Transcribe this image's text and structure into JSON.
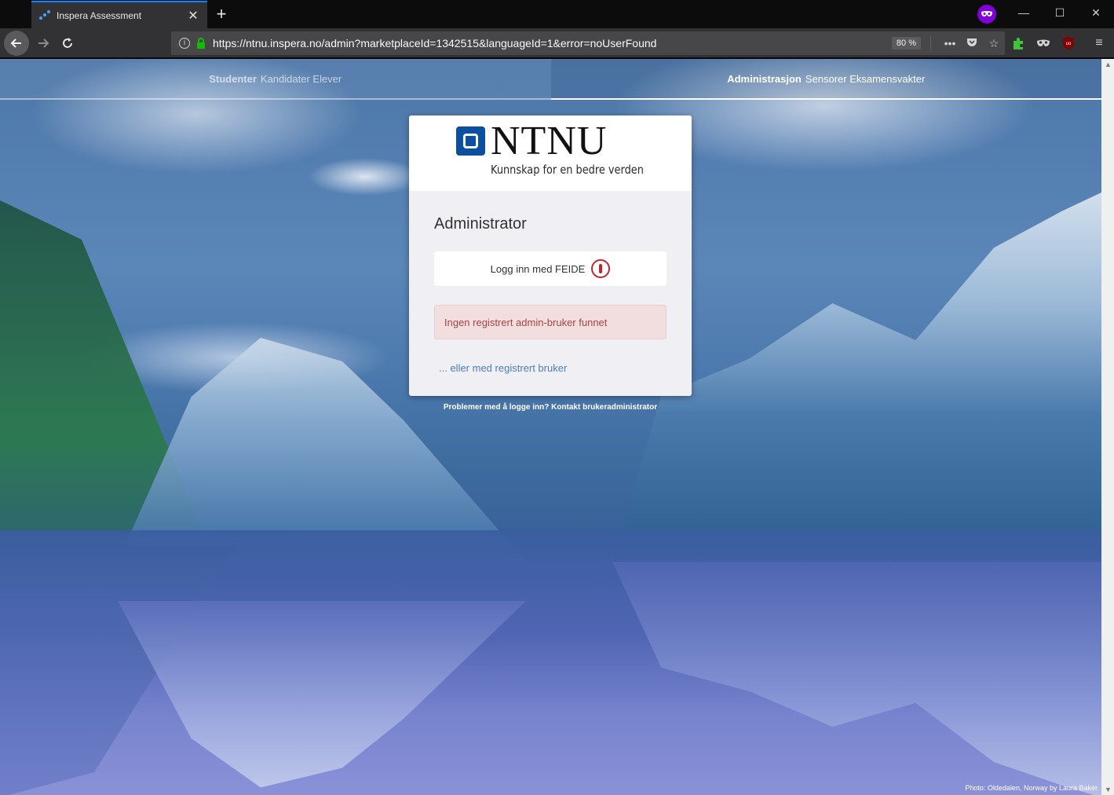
{
  "browser": {
    "tab_title": "Inspera Assessment",
    "tab_close": "✕",
    "new_tab": "+",
    "url": "https://ntnu.inspera.no/admin?marketplaceId=1342515&languageId=1&error=noUserFound",
    "zoom": "80 %",
    "icons": [
      "back-icon",
      "forward-icon",
      "reload-icon",
      "info-icon",
      "lock-icon",
      "more-icon",
      "pocket-icon",
      "star-icon",
      "extension-icon",
      "mask-icon",
      "ublock-icon",
      "menu-icon",
      "private-browsing-icon"
    ],
    "accent": "#0a84ff",
    "private_color": "#8000d7"
  },
  "role_tabs": [
    {
      "bold": "Studenter",
      "rest": "Kandidater Elever",
      "active": false
    },
    {
      "bold": "Administrasjon",
      "rest": "Sensorer Eksamensvakter",
      "active": true
    }
  ],
  "logo": {
    "wordmark": "NTNU",
    "tagline": "Kunnskap for en bedre verden",
    "color": "#0b4fa0"
  },
  "login": {
    "title": "Administrator",
    "feide_button": "Logg inn med FEIDE",
    "error_message": "Ingen registrert admin-bruker funnet",
    "alt_login_link": "... eller med registrert bruker",
    "error_color": "#a94442"
  },
  "footer": {
    "problems": "Problemer med å logge inn? Kontakt brukeradministrator",
    "photo_credit": "Photo: Oldedalen, Norway by Laura Baker"
  }
}
